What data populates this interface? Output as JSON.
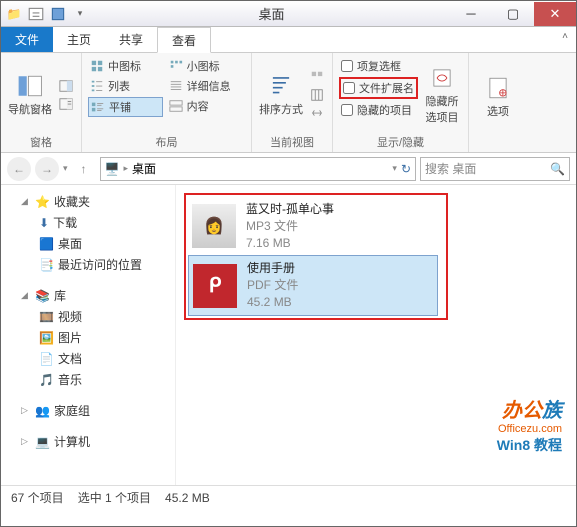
{
  "title": "桌面",
  "tabs": {
    "file": "文件",
    "home": "主页",
    "share": "共享",
    "view": "查看"
  },
  "ribbon": {
    "panes": {
      "label": "窗格",
      "nav": "导航窗格"
    },
    "layout": {
      "label": "布局",
      "medium": "中图标",
      "small": "小图标",
      "list": "列表",
      "details": "详细信息",
      "tiles": "平铺",
      "content": "内容"
    },
    "current": {
      "label": "当前视图",
      "sort": "排序方式"
    },
    "showhide": {
      "label": "显示/隐藏",
      "checkboxes": "项复选框",
      "extensions": "文件扩展名",
      "hidden": "隐藏的项目",
      "hidesel": "隐藏所\n选项目"
    },
    "options": "选项"
  },
  "breadcrumb": {
    "location": "桌面"
  },
  "search": {
    "placeholder": "搜索 桌面"
  },
  "tree": {
    "fav": "收藏夹",
    "downloads": "下载",
    "desktop": "桌面",
    "recent": "最近访问的位置",
    "libraries": "库",
    "videos": "视频",
    "pictures": "图片",
    "documents": "文档",
    "music": "音乐",
    "homegroup": "家庭组",
    "computer": "计算机"
  },
  "files": [
    {
      "name": "蓝又时-孤单心事",
      "type": "MP3 文件",
      "size": "7.16 MB"
    },
    {
      "name": "使用手册",
      "type": "PDF 文件",
      "size": "45.2 MB"
    }
  ],
  "status": {
    "total": "67 个项目",
    "selected": "选中 1 个项目",
    "size": "45.2 MB"
  },
  "watermark": {
    "brand1": "办公",
    "brand2": "族",
    "url": "Officezu.com",
    "tut": "Win8 教程"
  }
}
